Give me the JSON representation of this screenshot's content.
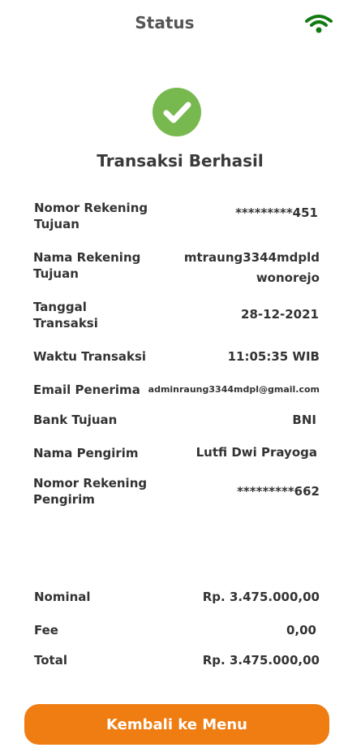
{
  "header": {
    "title": "Status",
    "wifi_icon": "wifi-icon",
    "wifi_color": "#137a13"
  },
  "result": {
    "success_icon": "check-circle-icon",
    "success_color": "#78b94f",
    "title": "Transaksi Berhasil"
  },
  "details": [
    {
      "label_line1": "Nomor Rekening",
      "label_line2": "Tujuan",
      "value_line1": "*********451",
      "value_line2": ""
    },
    {
      "label_line1": "Nama Rekening",
      "label_line2": "Tujuan",
      "value_line1": "mtraung3344mdpld",
      "value_line2": "wonorejo"
    },
    {
      "label_line1": "Tanggal",
      "label_line2": "Transaksi",
      "value_line1": "28-12-2021",
      "value_line2": ""
    },
    {
      "label_line1": "Waktu Transaksi",
      "label_line2": "",
      "value_line1": "11:05:35 WIB",
      "value_line2": ""
    },
    {
      "label_line1": "Email Penerima",
      "label_line2": "",
      "value_line1": "adminraung3344mdpl@gmail.com",
      "value_line2": ""
    },
    {
      "label_line1": "Bank Tujuan",
      "label_line2": "",
      "value_line1": "BNI",
      "value_line2": ""
    },
    {
      "label_line1": "Nama Pengirim",
      "label_line2": "",
      "value_line1": "Lutfi Dwi Prayoga",
      "value_line2": ""
    },
    {
      "label_line1": "Nomor Rekening",
      "label_line2": "Pengirim",
      "value_line1": "*********662",
      "value_line2": ""
    }
  ],
  "summary": [
    {
      "label": "Nominal",
      "value": "Rp. 3.475.000,00"
    },
    {
      "label": "Fee",
      "value": "0,00"
    },
    {
      "label": "Total",
      "value": "Rp. 3.475.000,00"
    }
  ],
  "footer": {
    "button_label": "Kembali ke Menu",
    "button_color": "#ef7d12"
  }
}
